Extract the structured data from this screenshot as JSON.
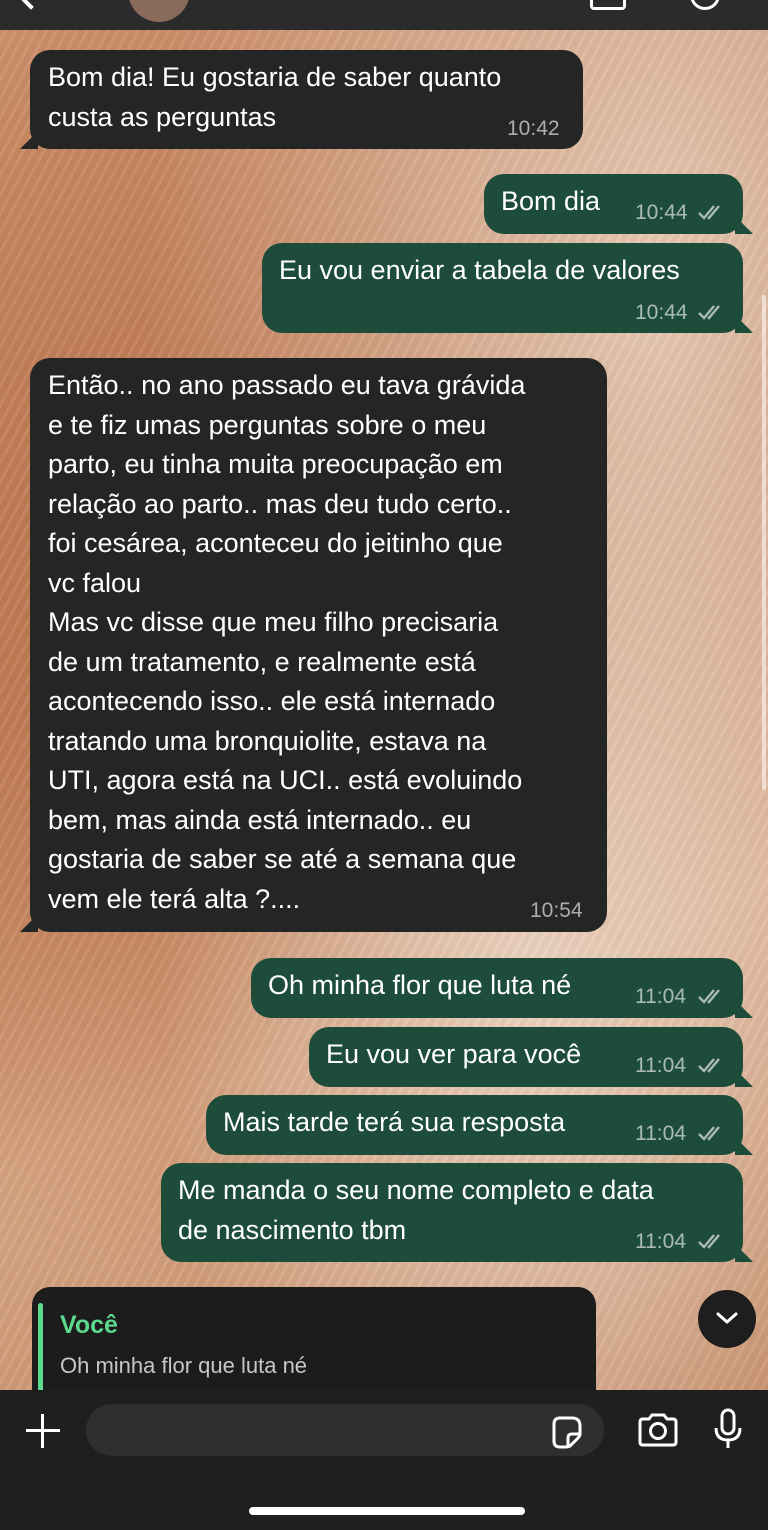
{
  "header": {
    "title": ""
  },
  "messages": [
    {
      "dir": "in",
      "text": "Bom dia! Eu gostaria de saber quanto\ncusta as perguntas",
      "time": "10:42"
    },
    {
      "dir": "out",
      "text": "Bom dia",
      "time": "10:44",
      "read": true
    },
    {
      "dir": "out",
      "text": "Eu vou enviar a tabela de valores",
      "time": "10:44",
      "read": true
    },
    {
      "dir": "in",
      "text": "Então.. no ano passado eu tava grávida\ne te fiz umas perguntas sobre o meu\nparto, eu tinha muita preocupação em\nrelação ao parto.. mas deu tudo certo..\nfoi cesárea, aconteceu do jeitinho que\nvc falou\nMas vc disse que meu filho precisaria\nde um tratamento, e realmente está\nacontecendo isso.. ele está internado\ntratando uma bronquiolite, estava na\nUTI, agora está na UCI.. está evoluindo\nbem, mas ainda está internado.. eu\ngostaria de saber se até a semana que\nvem ele terá alta ?....",
      "time": "10:54"
    },
    {
      "dir": "out",
      "text": "Oh minha flor que luta né",
      "time": "11:04",
      "read": true
    },
    {
      "dir": "out",
      "text": "Eu vou ver para você",
      "time": "11:04",
      "read": true
    },
    {
      "dir": "out",
      "text": "Mais tarde terá sua resposta",
      "time": "11:04",
      "read": true
    },
    {
      "dir": "out",
      "text": "Me manda o seu nome completo e data\nde nascimento tbm",
      "time": "11:04",
      "read": true
    }
  ],
  "reply_preview": {
    "author": "Você",
    "quoted_text": "Oh minha flor que luta né"
  },
  "composer": {
    "value": "",
    "placeholder": ""
  },
  "colors": {
    "incoming_bubble": "#242626",
    "outgoing_bubble": "#1e4c3b",
    "accent_green": "#5dd98e",
    "footer": "#1f1f1f"
  },
  "icons": [
    "back-icon",
    "video-call-icon",
    "voice-call-icon",
    "chevron-down-icon",
    "plus-icon",
    "sticker-icon",
    "camera-icon",
    "microphone-icon",
    "double-check-icon"
  ]
}
